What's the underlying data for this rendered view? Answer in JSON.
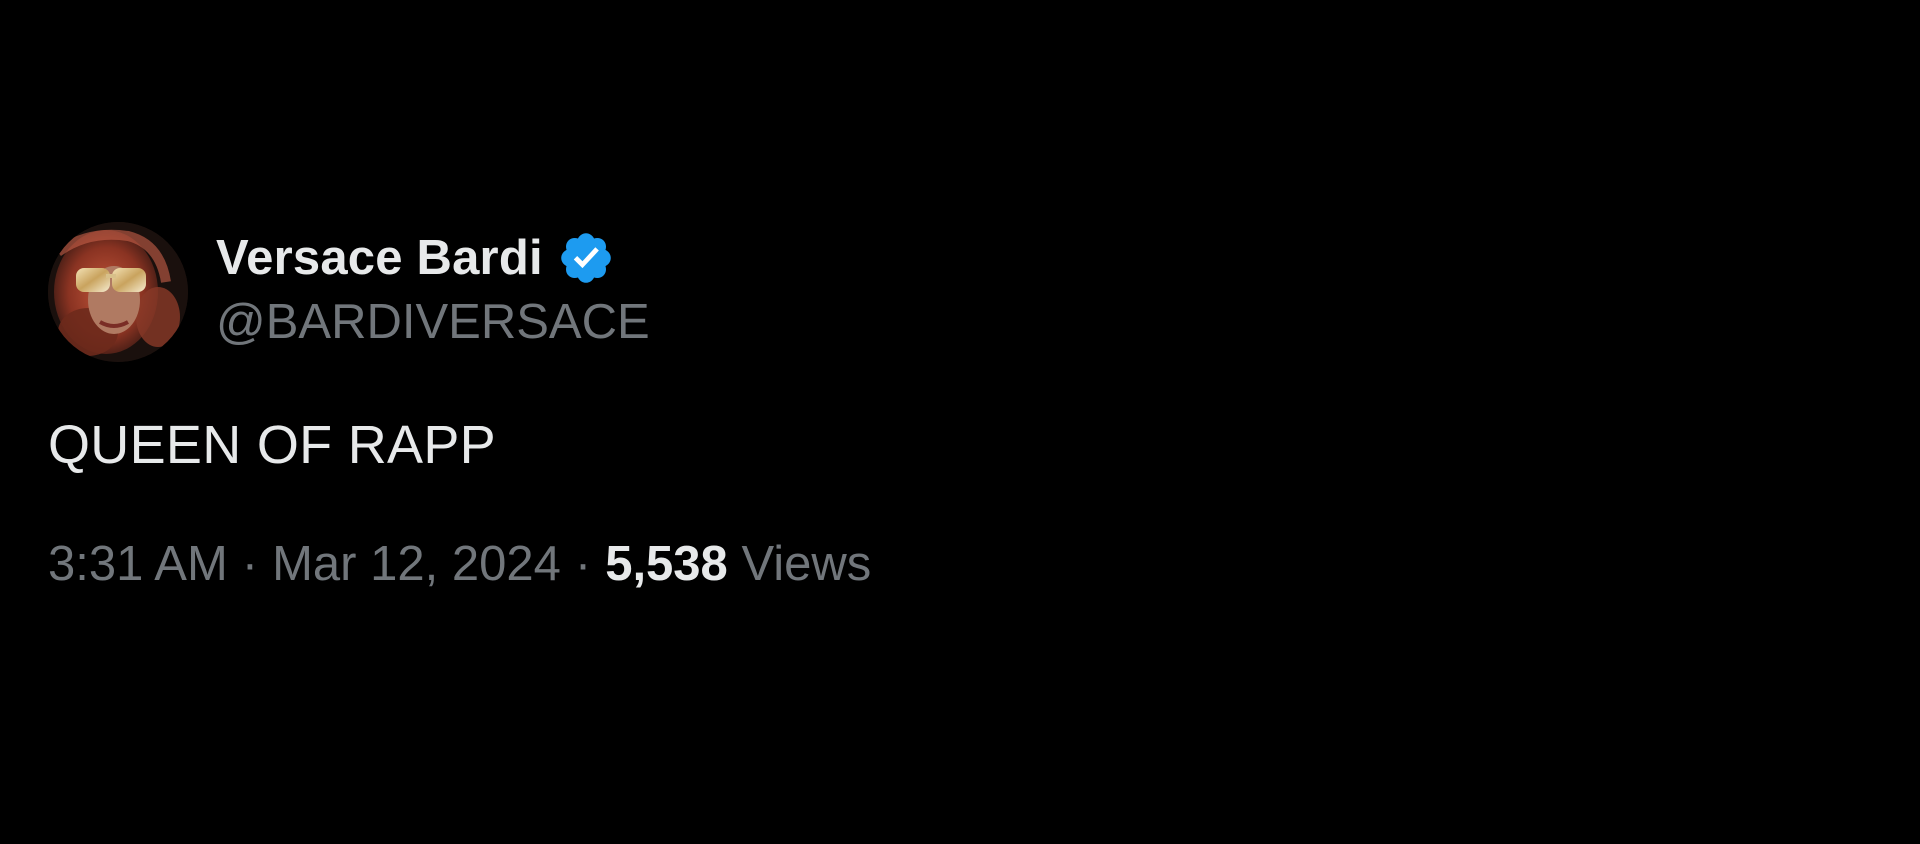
{
  "tweet": {
    "author": {
      "display_name": "Versace Bardi",
      "handle": "@BARDIVERSACE",
      "verified": true,
      "avatar_icon": "profile-photo"
    },
    "text": "QUEEN OF RAPP",
    "time": "3:31 AM",
    "separator": "·",
    "date": "Mar 12, 2024",
    "views_count": "5,538",
    "views_label": "Views"
  },
  "colors": {
    "background": "#000000",
    "primary_text": "#e7e9ea",
    "secondary_text": "#71767b",
    "verified_badge": "#1d9bf0"
  }
}
